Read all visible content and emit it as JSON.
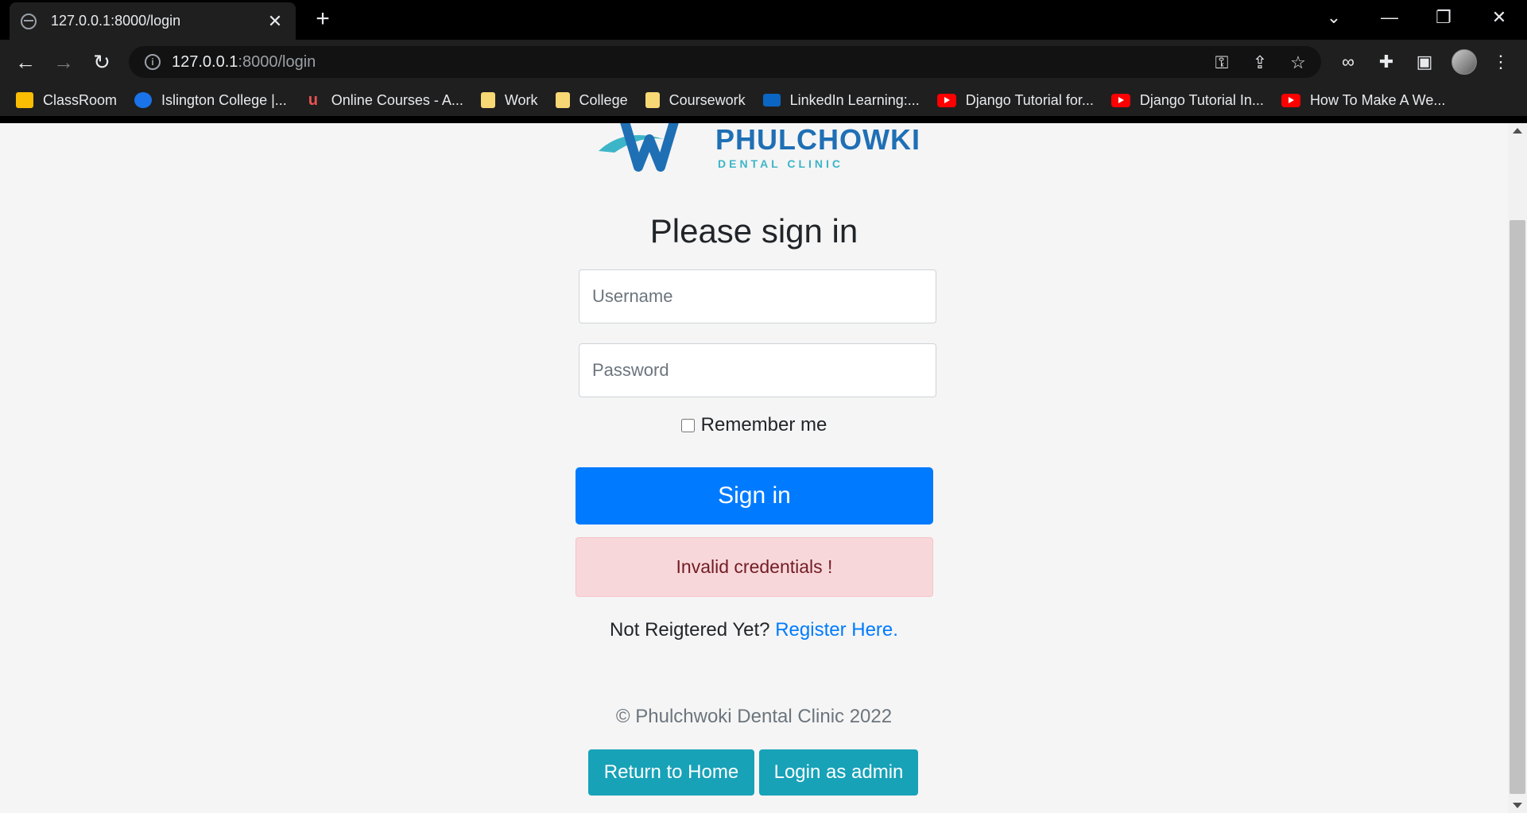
{
  "browser": {
    "tab_title": "127.0.0.1:8000/login",
    "url_host": "127.0.0.1",
    "url_path": ":8000/login",
    "bookmarks": [
      {
        "label": "ClassRoom",
        "icon": "google-classroom-icon"
      },
      {
        "label": "Islington College |...",
        "icon": "islington-icon"
      },
      {
        "label": "Online Courses - A...",
        "icon": "udemy-icon"
      },
      {
        "label": "Work",
        "icon": "folder-icon"
      },
      {
        "label": "College",
        "icon": "folder-icon"
      },
      {
        "label": "Coursework",
        "icon": "folder-icon"
      },
      {
        "label": "LinkedIn Learning:...",
        "icon": "linkedin-learning-icon"
      },
      {
        "label": "Django Tutorial for...",
        "icon": "youtube-icon"
      },
      {
        "label": "Django Tutorial In...",
        "icon": "youtube-icon"
      },
      {
        "label": "How To Make A We...",
        "icon": "youtube-icon"
      }
    ]
  },
  "logo": {
    "name": "PHULCHOWKI",
    "subtitle": "DENTAL CLINIC"
  },
  "form": {
    "title": "Please sign in",
    "username_placeholder": "Username",
    "password_placeholder": "Password",
    "remember_label": "Remember me",
    "submit_label": "Sign in",
    "error_message": "Invalid credentials !",
    "register_prompt": "Not Reigtered Yet?",
    "register_link": "Register Here."
  },
  "footer": {
    "copyright": "© Phulchwoki Dental Clinic 2022",
    "home_button": "Return to Home",
    "admin_button": "Login as admin"
  },
  "colors": {
    "primary": "#007bff",
    "teal": "#17a2b8",
    "alert_bg": "#f8d7da",
    "alert_text": "#721c24",
    "logo_blue": "#1f6fb5",
    "logo_teal": "#3db5c8"
  }
}
